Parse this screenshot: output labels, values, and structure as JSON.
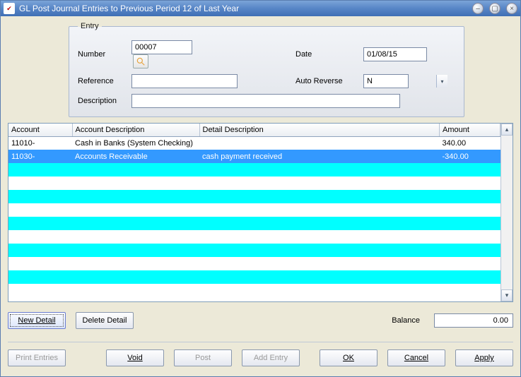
{
  "window": {
    "title": "GL Post Journal Entries to Previous Period 12 of Last Year"
  },
  "entry": {
    "legend": "Entry",
    "labels": {
      "number": "Number",
      "reference": "Reference",
      "description": "Description",
      "date": "Date",
      "auto_reverse": "Auto Reverse"
    },
    "values": {
      "number": "00007",
      "reference": "",
      "description": "",
      "date": "01/08/15",
      "auto_reverse": "N"
    }
  },
  "grid": {
    "headers": {
      "account": "Account",
      "account_description": "Account Description",
      "detail_description": "Detail Description",
      "amount": "Amount"
    },
    "rows": [
      {
        "account": "11010-",
        "account_description": "Cash in Banks (System Checking)",
        "detail_description": "",
        "amount": "340.00",
        "selected": false
      },
      {
        "account": "11030-",
        "account_description": "Accounts Receivable",
        "detail_description": "cash payment received",
        "amount": "-340.00",
        "selected": true
      }
    ]
  },
  "balance": {
    "label": "Balance",
    "value": "0.00"
  },
  "buttons": {
    "new_detail": "New Detail",
    "delete_detail": "Delete Detail",
    "print_entries": "Print Entries",
    "void": "Void",
    "post": "Post",
    "add_entry": "Add Entry",
    "ok": "OK",
    "cancel": "Cancel",
    "apply": "Apply"
  }
}
